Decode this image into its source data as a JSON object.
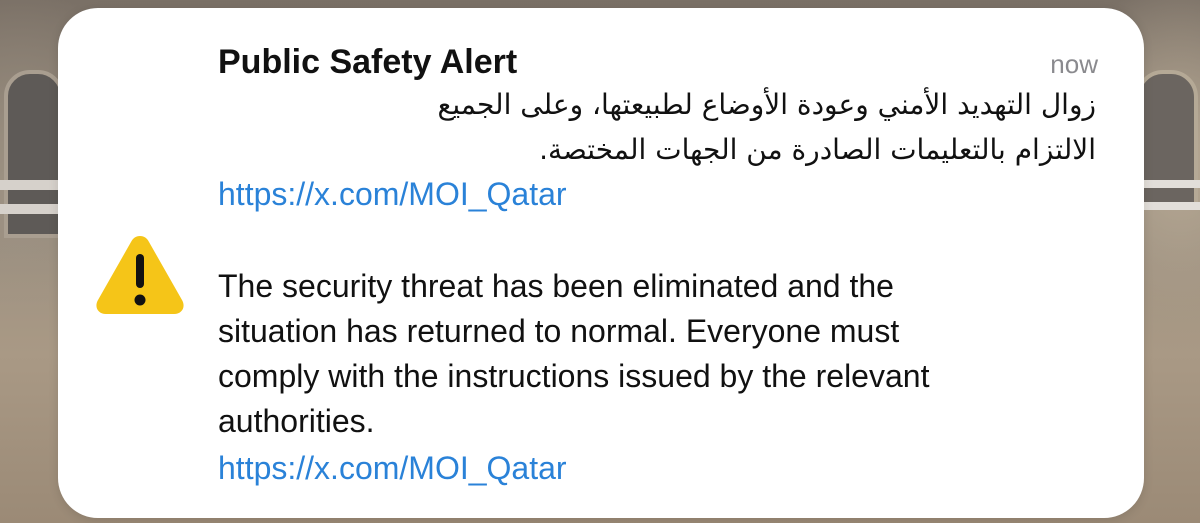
{
  "notification": {
    "title": "Public Safety Alert",
    "timestamp": "now",
    "icon": "warning-triangle-icon",
    "icon_color": "#F5C518",
    "arabic_lines": [
      "زوال التهديد الأمني وعودة الأوضاع لطبيعتها، وعلى الجميع",
      "الالتزام بالتعليمات الصادرة من الجهات المختصة."
    ],
    "link_arabic": "https://x.com/MOI_Qatar",
    "english_lines": [
      "The security threat has been eliminated and the",
      "situation has returned to normal. Everyone must",
      "comply with the instructions issued by the relevant",
      "authorities."
    ],
    "link_english": "https://x.com/MOI_Qatar",
    "link_color": "#2A82D8"
  }
}
